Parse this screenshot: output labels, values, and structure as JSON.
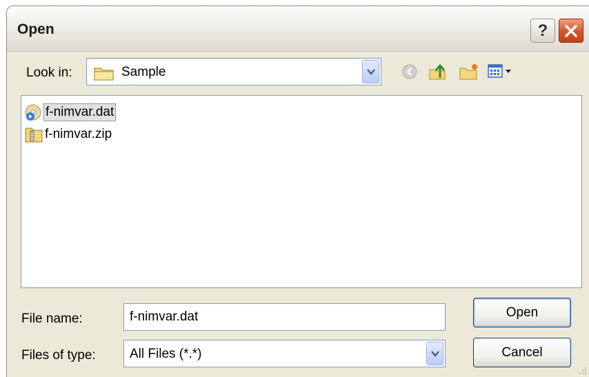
{
  "dialog": {
    "title": "Open"
  },
  "titlebar": {
    "help_label": "?"
  },
  "look_in": {
    "label": "Look in:",
    "value": "Sample"
  },
  "files": [
    {
      "name": "f-nimvar.dat",
      "icon": "media-file-icon",
      "selected": true
    },
    {
      "name": "f-nimvar.zip",
      "icon": "zip-folder-icon",
      "selected": false
    }
  ],
  "file_name": {
    "label": "File name:",
    "value": "f-nimvar.dat"
  },
  "file_type": {
    "label": "Files of type:",
    "value": "All Files (*.*)"
  },
  "buttons": {
    "open": "Open",
    "cancel": "Cancel"
  }
}
